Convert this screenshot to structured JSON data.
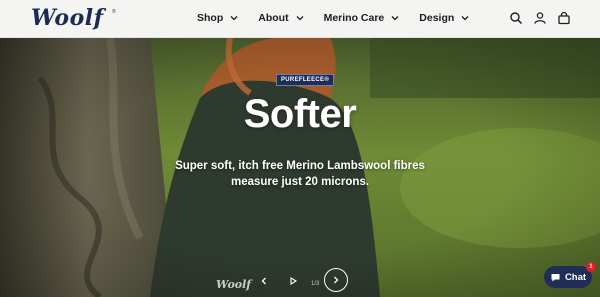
{
  "brand": {
    "logo_text": "Woolf",
    "logo_mark": "®"
  },
  "nav": {
    "items": [
      {
        "label": "Shop"
      },
      {
        "label": "About"
      },
      {
        "label": "Merino Care"
      },
      {
        "label": "Design"
      }
    ]
  },
  "header_icons": [
    "search-icon",
    "account-icon",
    "cart-icon"
  ],
  "hero": {
    "badge": "PUREFLEECE®",
    "headline": "Softer",
    "subtext_line1": "Super soft, itch free Merino Lambswool fibres",
    "subtext_line2": "measure just 20 microns.",
    "watermark": "Woolf",
    "slide_counter": "1/3"
  },
  "chat": {
    "label": "Chat",
    "badge_count": "1"
  },
  "colors": {
    "brand_navy": "#1d2b52",
    "header_bg": "#f4f4f3",
    "chat_badge": "#d9212c"
  }
}
